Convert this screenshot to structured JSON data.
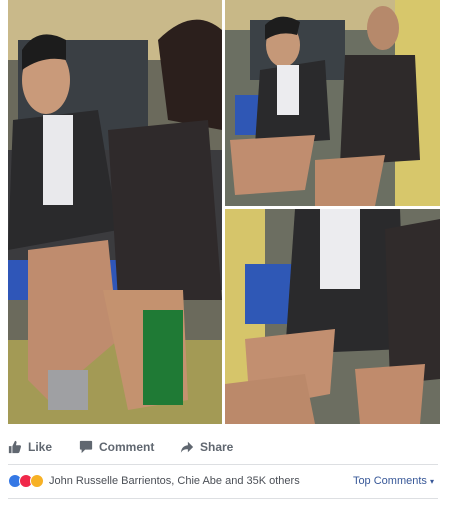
{
  "post": {
    "photos": [
      {
        "name": "photo-main",
        "desc_icon": "jeepney-passengers-photo"
      },
      {
        "name": "photo-top-right",
        "desc_icon": "jeepney-passengers-photo"
      },
      {
        "name": "photo-bottom-right",
        "desc_icon": "jeepney-passengers-photo"
      }
    ]
  },
  "actions": {
    "like_label": "Like",
    "comment_label": "Comment",
    "share_label": "Share"
  },
  "reactions": {
    "icons": [
      "like-reaction-icon",
      "love-reaction-icon",
      "wow-reaction-icon"
    ],
    "summary": "John Russelle Barrientos, Chie Abe and 35K others",
    "sort_label": "Top Comments"
  },
  "colors": {
    "link": "#385898",
    "action_text": "#606770",
    "like_blue": "#3578e5",
    "love_red": "#f0284a",
    "wow_yellow": "#f7b125"
  }
}
